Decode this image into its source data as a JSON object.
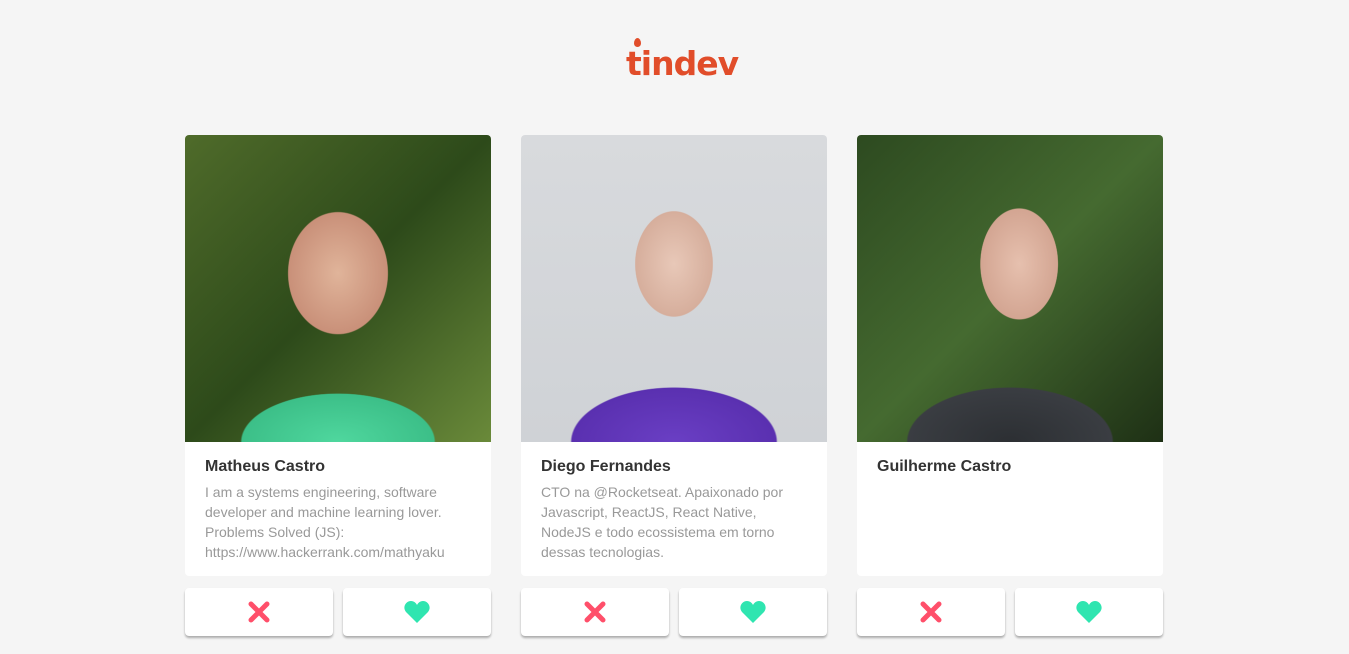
{
  "logo": "tindev",
  "colors": {
    "logo": "#e14d2a",
    "dislike": "#ff4f6a",
    "like": "#2fe5b0"
  },
  "users": [
    {
      "name": "Matheus Castro",
      "bio": "I am a systems engineering, software developer and machine learning lover. Problems Solved (JS): https://www.hackerrank.com/mathyaku"
    },
    {
      "name": "Diego Fernandes",
      "bio": "CTO na @Rocketseat. Apaixonado por Javascript, ReactJS, React Native, NodeJS e todo ecossistema em torno dessas tecnologias."
    },
    {
      "name": "Guilherme Castro",
      "bio": ""
    }
  ]
}
